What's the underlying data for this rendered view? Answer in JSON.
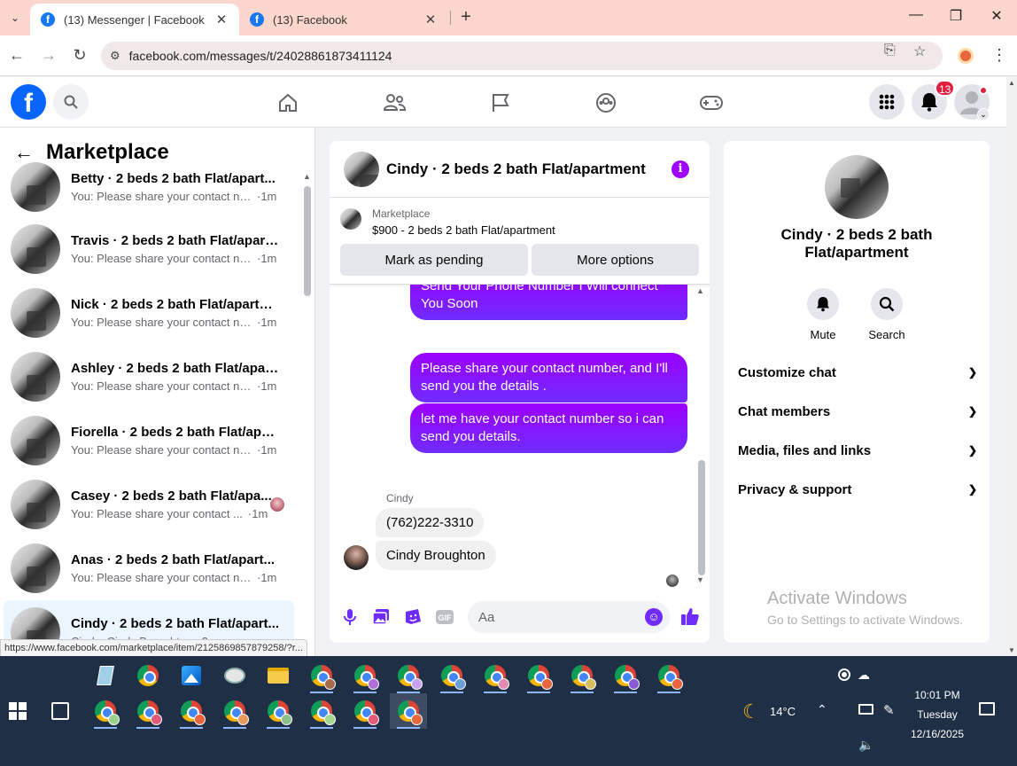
{
  "browser": {
    "tabs": [
      {
        "title": "(13) Messenger | Facebook",
        "active": true
      },
      {
        "title": "(13) Facebook",
        "active": false
      }
    ],
    "url": "facebook.com/messages/t/24028861873411124",
    "status_url": "https://www.facebook.com/marketplace/item/2125869857879258/?r..."
  },
  "fb": {
    "notification_count": "13",
    "brand_color": "#0866ff"
  },
  "sidebar": {
    "title": "Marketplace",
    "conversations": [
      {
        "name": "Betty · 2 beds 2 bath Flat/apart...",
        "preview": "You: Please share your contact nu...",
        "time": "·1m"
      },
      {
        "name": "Travis · 2 beds 2 bath Flat/apart...",
        "preview": "You: Please share your contact nu...",
        "time": "·1m"
      },
      {
        "name": "Nick · 2 beds 2 bath Flat/apartm...",
        "preview": "You: Please share your contact nu...",
        "time": "·1m"
      },
      {
        "name": "Ashley · 2 beds 2 bath Flat/apart...",
        "preview": "You: Please share your contact nu...",
        "time": "·1m"
      },
      {
        "name": "Fiorella · 2 beds 2 bath Flat/apar...",
        "preview": "You: Please share your contact nu...",
        "time": "·1m"
      },
      {
        "name": "Casey · 2 beds 2 bath Flat/apa...",
        "preview": "You: Please share your contact ...",
        "time": "·1m"
      },
      {
        "name": "Anas · 2 beds 2 bath Flat/apart...",
        "preview": "You: Please share your contact nu...",
        "time": "·1m"
      },
      {
        "name": "Cindy · 2 beds 2 bath Flat/apart...",
        "preview": "Cindy: Cindy Broughton",
        "time": "·2m"
      }
    ]
  },
  "chat": {
    "title": "Cindy · 2 beds 2 bath Flat/apartment",
    "marketplace_label": "Marketplace",
    "listing": "$900 - 2 beds 2 bath Flat/apartment",
    "mark_pending": "Mark as pending",
    "more_options": "More options",
    "messages_out": [
      "Send Your Phone Number I Will connect You Soon",
      "Please share your contact number, and I'll send you the details .",
      "let me have your contact number so i can send you details."
    ],
    "sender_name": "Cindy",
    "messages_in": [
      "(762)222-3310",
      "Cindy Broughton"
    ],
    "input_placeholder": "Aa",
    "accent_color": "#9d00ff"
  },
  "info_panel": {
    "name": "Cindy · 2 beds 2 bath Flat/apartment",
    "mute_label": "Mute",
    "search_label": "Search",
    "sections": [
      "Customize chat",
      "Chat members",
      "Media, files and links",
      "Privacy & support"
    ]
  },
  "watermark": {
    "title": "Activate Windows",
    "subtitle": "Go to Settings to activate Windows."
  },
  "taskbar": {
    "temperature": "14°C",
    "time": "10:01 PM",
    "day": "Tuesday",
    "date": "12/16/2025"
  }
}
